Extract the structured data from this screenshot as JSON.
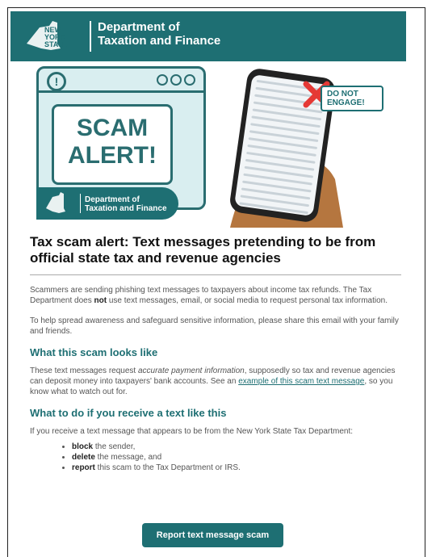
{
  "header": {
    "dept_line1": "Department of",
    "dept_line2": "Taxation and Finance",
    "logo_words": [
      "NEW",
      "YORK",
      "STATE"
    ]
  },
  "hero": {
    "alert_text_1": "SCAM",
    "alert_text_2": "ALERT!",
    "mini_dept_line1": "Department of",
    "mini_dept_line2": "Taxation and Finance",
    "do_not_engage": "DO NOT ENGAGE!"
  },
  "article": {
    "title": "Tax scam alert: Text messages pretending to be from official state tax and revenue agencies",
    "p1_a": "Scammers are sending phishing text messages to taxpayers about income tax refunds. The Tax Department does ",
    "p1_bold": "not",
    "p1_b": " use text messages, email, or social media to request personal tax information.",
    "p2": "To help spread awareness and safeguard sensitive information, please share this email with your family and friends.",
    "h_looks": "What this scam looks like",
    "p3_a": "These text messages request ",
    "p3_em": "accurate payment information",
    "p3_b": ", supposedly so tax and revenue agencies can deposit money into taxpayers' bank accounts. See an ",
    "p3_link": "example of this scam text message",
    "p3_c": ", so you know what to watch out for.",
    "h_todo": "What to do if you receive a text like this",
    "p4": "If you receive a text message that appears to be from the New York State Tax Department:",
    "bullets": [
      {
        "bold": "block",
        "rest": " the sender,"
      },
      {
        "bold": "delete",
        "rest": " the message, and"
      },
      {
        "bold": "report",
        "rest": " this scam to the Tax Department or IRS."
      }
    ],
    "button": "Report text message scam"
  },
  "colors": {
    "brand": "#1e6f73",
    "panel": "#d9eef0",
    "alert_red": "#e53935"
  }
}
